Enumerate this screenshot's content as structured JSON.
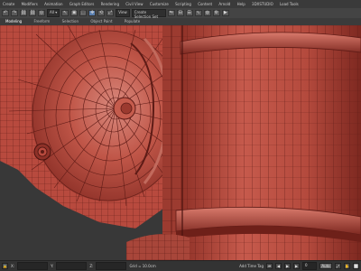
{
  "menu": [
    "Create",
    "Modifiers",
    "Animation",
    "Graph Editors",
    "Rendering",
    "Civil View",
    "Customize",
    "Scripting",
    "Content",
    "Arnold",
    "Help",
    "3DXSTUDIO",
    "Load Tools"
  ],
  "toolbar": {
    "buttons": [
      "↶",
      "↷",
      "⛓",
      "⛓",
      "◎",
      "▦",
      "↖",
      "▣",
      "⬚",
      "✥",
      "⟲",
      "⤢"
    ],
    "selection_set": "Create Selection Set",
    "view_dropdown": "View"
  },
  "ribbon": {
    "tabs": [
      "Modeling",
      "Freeform",
      "Selection",
      "Object Paint",
      "Populate"
    ]
  },
  "status": {
    "x": "X:",
    "y": "Y:",
    "z": "Z:",
    "grid": "Grid = 10.0cm",
    "add_time_tag": "Add Time Tag",
    "frame": "0",
    "auto_key": "Auto",
    "selected": "Selected"
  },
  "colors": {
    "model": "#b84a3e",
    "wire": "#5e1b16",
    "background": "#383838"
  }
}
